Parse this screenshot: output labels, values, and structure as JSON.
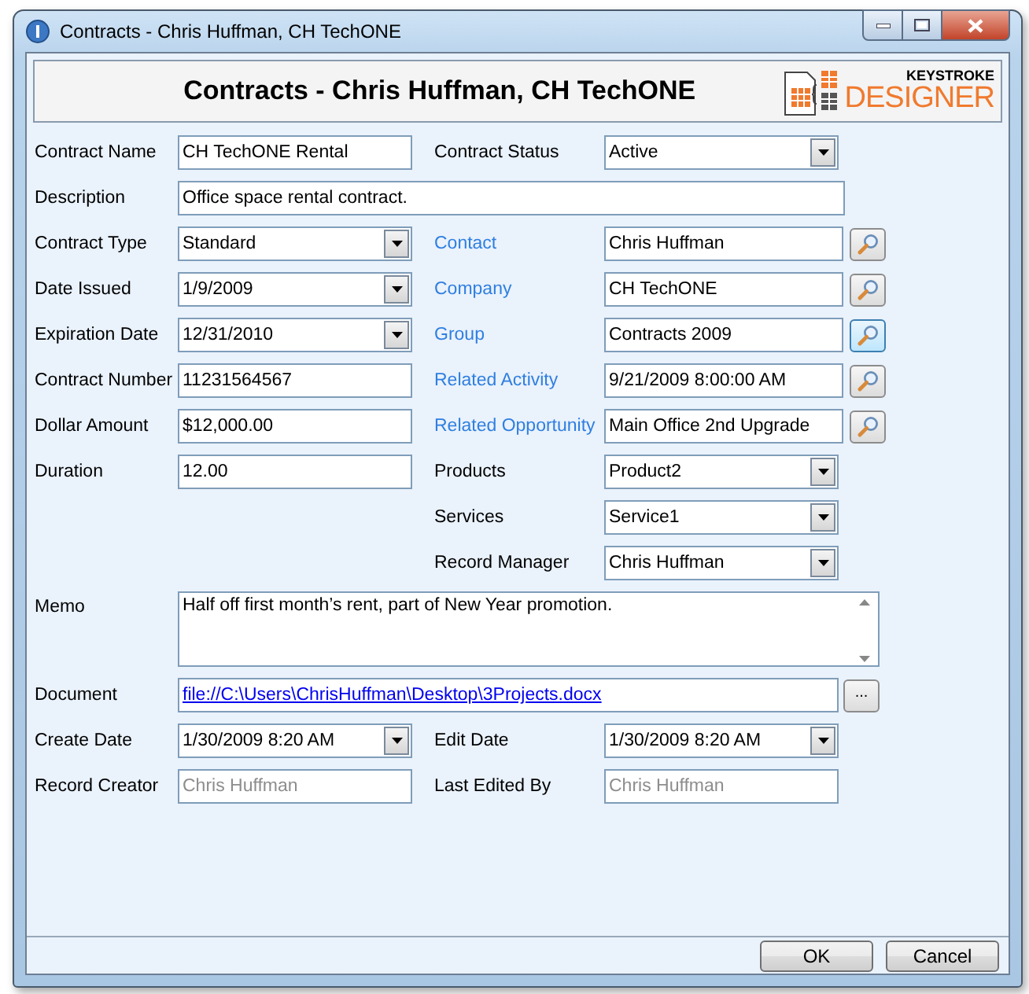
{
  "window": {
    "title": "Contracts - Chris Huffman, CH TechONE"
  },
  "header": {
    "title": "Contracts - Chris Huffman, CH TechONE",
    "logo_top": "KEYSTROKE",
    "logo_bottom": "DESIGNER"
  },
  "rows": [
    {
      "left": {
        "kind": "text",
        "label": "Contract Name",
        "value": "CH TechONE Rental"
      },
      "right": {
        "kind": "dropdown",
        "label": "Contract Status",
        "value": "Active"
      }
    },
    {
      "left": {
        "kind": "wide",
        "label": "Description",
        "value": "Office space rental contract."
      }
    },
    {
      "left": {
        "kind": "dropdown",
        "label": "Contract Type",
        "value": "Standard"
      },
      "right": {
        "kind": "lookup",
        "label": "Contact",
        "value": "Chris Huffman",
        "highlighted": false
      }
    },
    {
      "left": {
        "kind": "dropdown",
        "label": "Date Issued",
        "value": "1/9/2009"
      },
      "right": {
        "kind": "lookup",
        "label": "Company",
        "value": "CH TechONE",
        "highlighted": false
      }
    },
    {
      "left": {
        "kind": "dropdown",
        "label": "Expiration Date",
        "value": "12/31/2010"
      },
      "right": {
        "kind": "lookup",
        "label": "Group",
        "value": "Contracts 2009",
        "highlighted": true
      }
    },
    {
      "left": {
        "kind": "text",
        "label": "Contract Number",
        "value": "11231564567"
      },
      "right": {
        "kind": "lookup",
        "label": "Related Activity",
        "value": "9/21/2009 8:00:00 AM",
        "highlighted": false
      }
    },
    {
      "left": {
        "kind": "text",
        "label": "Dollar Amount",
        "value": "$12,000.00"
      },
      "right": {
        "kind": "lookup",
        "label": "Related Opportunity",
        "value": "Main Office 2nd Upgrade",
        "highlighted": false
      }
    },
    {
      "left": {
        "kind": "text",
        "label": "Duration",
        "value": "12.00"
      },
      "right": {
        "kind": "dropdown",
        "label": "Products",
        "value": "Product2"
      }
    },
    {
      "right": {
        "kind": "dropdown",
        "label": "Services",
        "value": "Service1"
      }
    },
    {
      "right": {
        "kind": "dropdown",
        "label": "Record Manager",
        "value": "Chris Huffman"
      }
    },
    {
      "left": {
        "kind": "memo",
        "label": "Memo",
        "value": "Half off first month’s rent, part of New Year promotion."
      }
    },
    {
      "left": {
        "kind": "file",
        "label": "Document",
        "value": "file://C:\\Users\\ChrisHuffman\\Desktop\\3Projects.docx",
        "button": "..."
      }
    },
    {
      "left": {
        "kind": "dropdown",
        "label": "Create Date",
        "value": "1/30/2009 8:20 AM"
      },
      "right": {
        "kind": "dropdown",
        "label": "Edit Date",
        "value": "1/30/2009 8:20 AM"
      }
    },
    {
      "left": {
        "kind": "readonly",
        "label": "Record Creator",
        "value": "Chris Huffman"
      },
      "right": {
        "kind": "readonly",
        "label": "Last Edited By",
        "value": "Chris Huffman"
      }
    }
  ],
  "buttons": [
    "OK",
    "Cancel"
  ]
}
